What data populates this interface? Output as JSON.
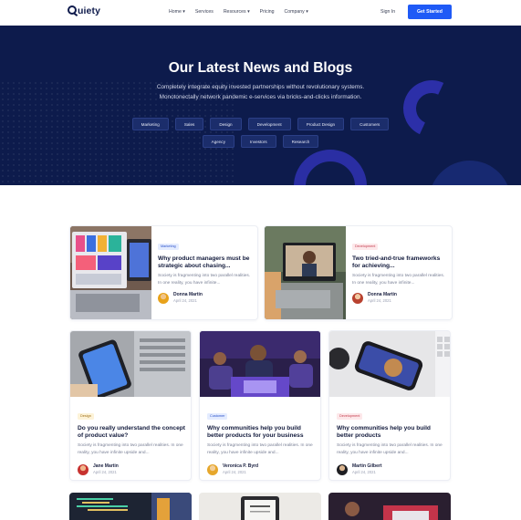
{
  "nav": {
    "logo": "uiety",
    "items": [
      "Home",
      "Services",
      "Resources",
      "Pricing",
      "Company"
    ],
    "has_dropdown": [
      true,
      false,
      true,
      false,
      true
    ],
    "signin": "Sign In",
    "cta": "Get Started"
  },
  "hero": {
    "title": "Our Latest News and Blogs",
    "subtitle": "Completely integrate equity invested partnerships without revolutionary systems. Monotonectally network pandemic e-services via bricks-and-clicks information.",
    "tags_row1": [
      "Marketing",
      "Sales",
      "Design",
      "Development",
      "Product Design",
      "Customers"
    ],
    "tags_row2": [
      "Agency",
      "Investors",
      "Research"
    ]
  },
  "featured": [
    {
      "tag": "Marketing",
      "title": "Why product managers must be strategic about chasing...",
      "excerpt": "Society is fragmenting into two parallel realities. In one reality, you have infinite...",
      "author": "Donna Martin",
      "date": "April 24, 2021"
    },
    {
      "tag": "Development",
      "title": "Two tried-and-true frameworks for achieving...",
      "excerpt": "Society is fragmenting into two parallel realities. In one reality, you have infinite...",
      "author": "Donna Martin",
      "date": "April 24, 2021"
    }
  ],
  "posts": [
    {
      "tag": "Design",
      "title": "Do you really understand the concept of product value?",
      "excerpt": "Society is fragmenting into two parallel realities. In one reality, you have infinite upside and...",
      "author": "Jane Martin",
      "date": "April 24, 2021"
    },
    {
      "tag": "Customer",
      "title": "Why communities help you build better products for your business",
      "excerpt": "Society is fragmenting into two parallel realities. In one reality, you have infinite upside and...",
      "author": "Veronica P. Byrd",
      "date": "April 24, 2021"
    },
    {
      "tag": "Development",
      "title": "Why communities help you build better products",
      "excerpt": "Society is fragmenting into two parallel realities. In one reality, you have infinite upside and...",
      "author": "Martin Gilbert",
      "date": "April 24, 2021"
    }
  ],
  "colors": {
    "hero_bg": "#0d1b4c",
    "accent": "#1f5af6"
  }
}
